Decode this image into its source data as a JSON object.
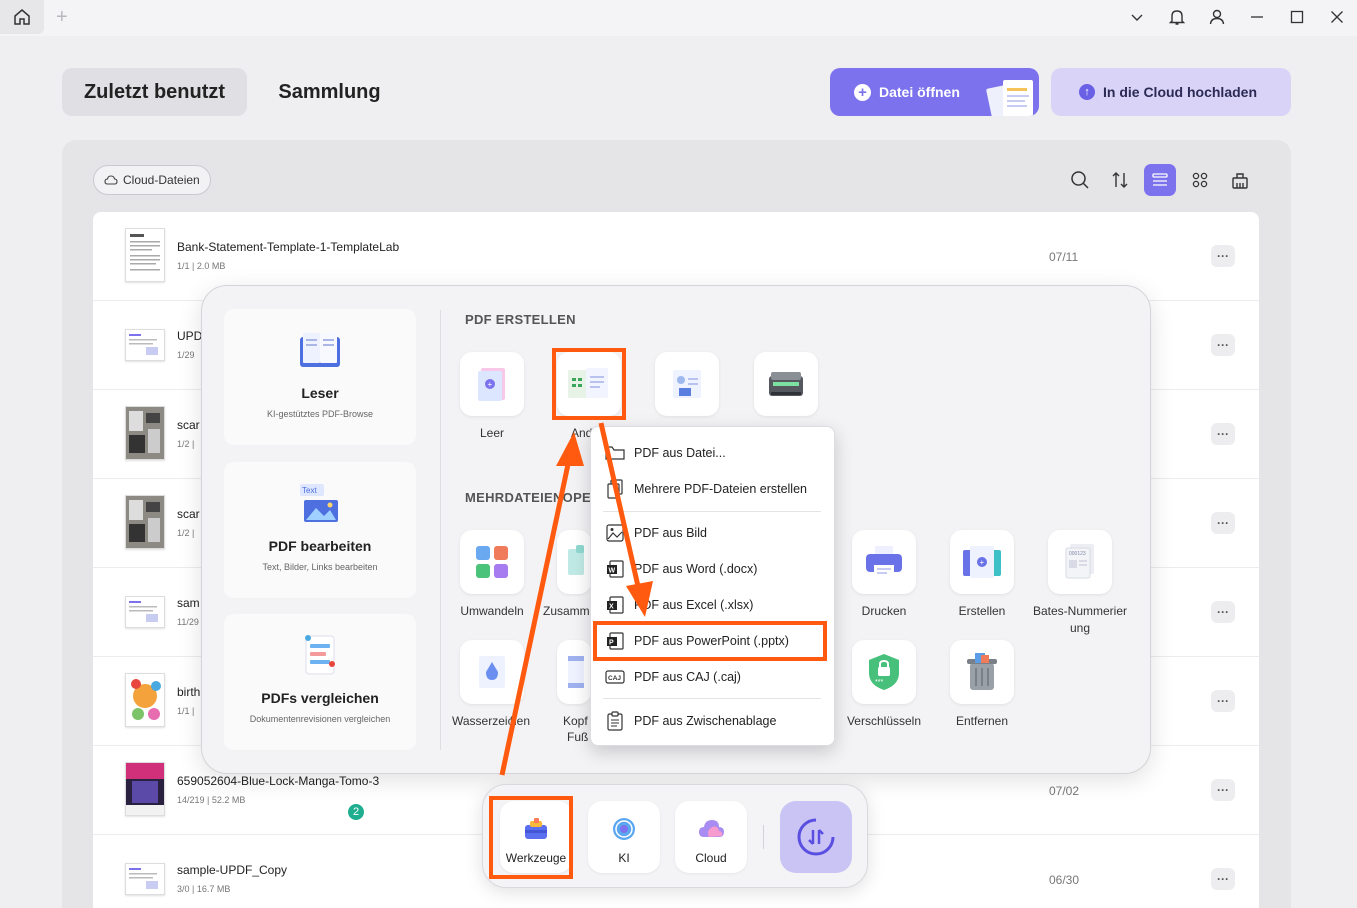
{
  "titlebar": {
    "icons": [
      "home-icon",
      "new-tab-plus-icon",
      "chevron-down-icon",
      "bell-icon",
      "user-icon",
      "minimize-icon",
      "maximize-icon",
      "close-icon"
    ]
  },
  "header": {
    "tab_recent": "Zuletzt benutzt",
    "tab_collection": "Sammlung",
    "open_file": "Datei öffnen",
    "upload_cloud": "In die Cloud hochladen"
  },
  "filter": {
    "cloud_files": "Cloud-Dateien"
  },
  "accent_color": "#7c72ee",
  "highlight_color": "#ff5a0f",
  "files": [
    {
      "name": "Bank-Statement-Template-1-TemplateLab",
      "meta": "1/1 | 2.0 MB",
      "date": "07/11"
    },
    {
      "name": "UPD",
      "meta": "1/29",
      "date": ""
    },
    {
      "name": "scar",
      "meta": "1/2 |",
      "date": ""
    },
    {
      "name": "scar",
      "meta": "1/2 |",
      "date": ""
    },
    {
      "name": "sam",
      "meta": "11/29",
      "date": ""
    },
    {
      "name": "birth",
      "meta": "1/1 |",
      "date": ""
    },
    {
      "name": "659052604-Blue-Lock-Manga-Tomo-3",
      "meta": "14/219 | 52.2 MB",
      "date": "07/02"
    },
    {
      "name": "sample-UPDF_Copy",
      "meta": "3/0 | 16.7 MB",
      "date": "06/30"
    }
  ],
  "more_label": "···",
  "tools_popup": {
    "cards": [
      {
        "title": "Leser",
        "sub": "KI-gestütztes PDF-Browse"
      },
      {
        "title": "PDF bearbeiten",
        "sub": "Text, Bilder, Links bearbeiten"
      },
      {
        "title": "PDFs vergleichen",
        "sub": "Dokumentenrevisionen vergleichen"
      }
    ],
    "create_title": "PDF ERSTELLEN",
    "create_tiles": [
      "Leer",
      "And"
    ],
    "multi_title": "MEHRDATEIENOPE",
    "multi_tiles": [
      "Umwandeln",
      "Zusamm",
      "Drucken",
      "Erstellen",
      "Bates-Nummerier",
      "ung"
    ],
    "row2_tiles": [
      "Wasserzeic",
      "hen",
      "Kopf",
      "Fuß",
      "Verschlüsseln",
      "Entfernen"
    ]
  },
  "dropdown": {
    "items": [
      "PDF aus Datei...",
      "Mehrere PDF-Dateien erstellen",
      "PDF aus Bild",
      "PDF aus Word (.docx)",
      "PDF aus Excel (.xlsx)",
      "PDF aus PowerPoint (.pptx)",
      "PDF aus CAJ (.caj)",
      "PDF aus Zwischenablage"
    ]
  },
  "dock": {
    "tools": "Werkzeuge",
    "ai": "KI",
    "cloud": "Cloud",
    "sync_badge": "2"
  }
}
